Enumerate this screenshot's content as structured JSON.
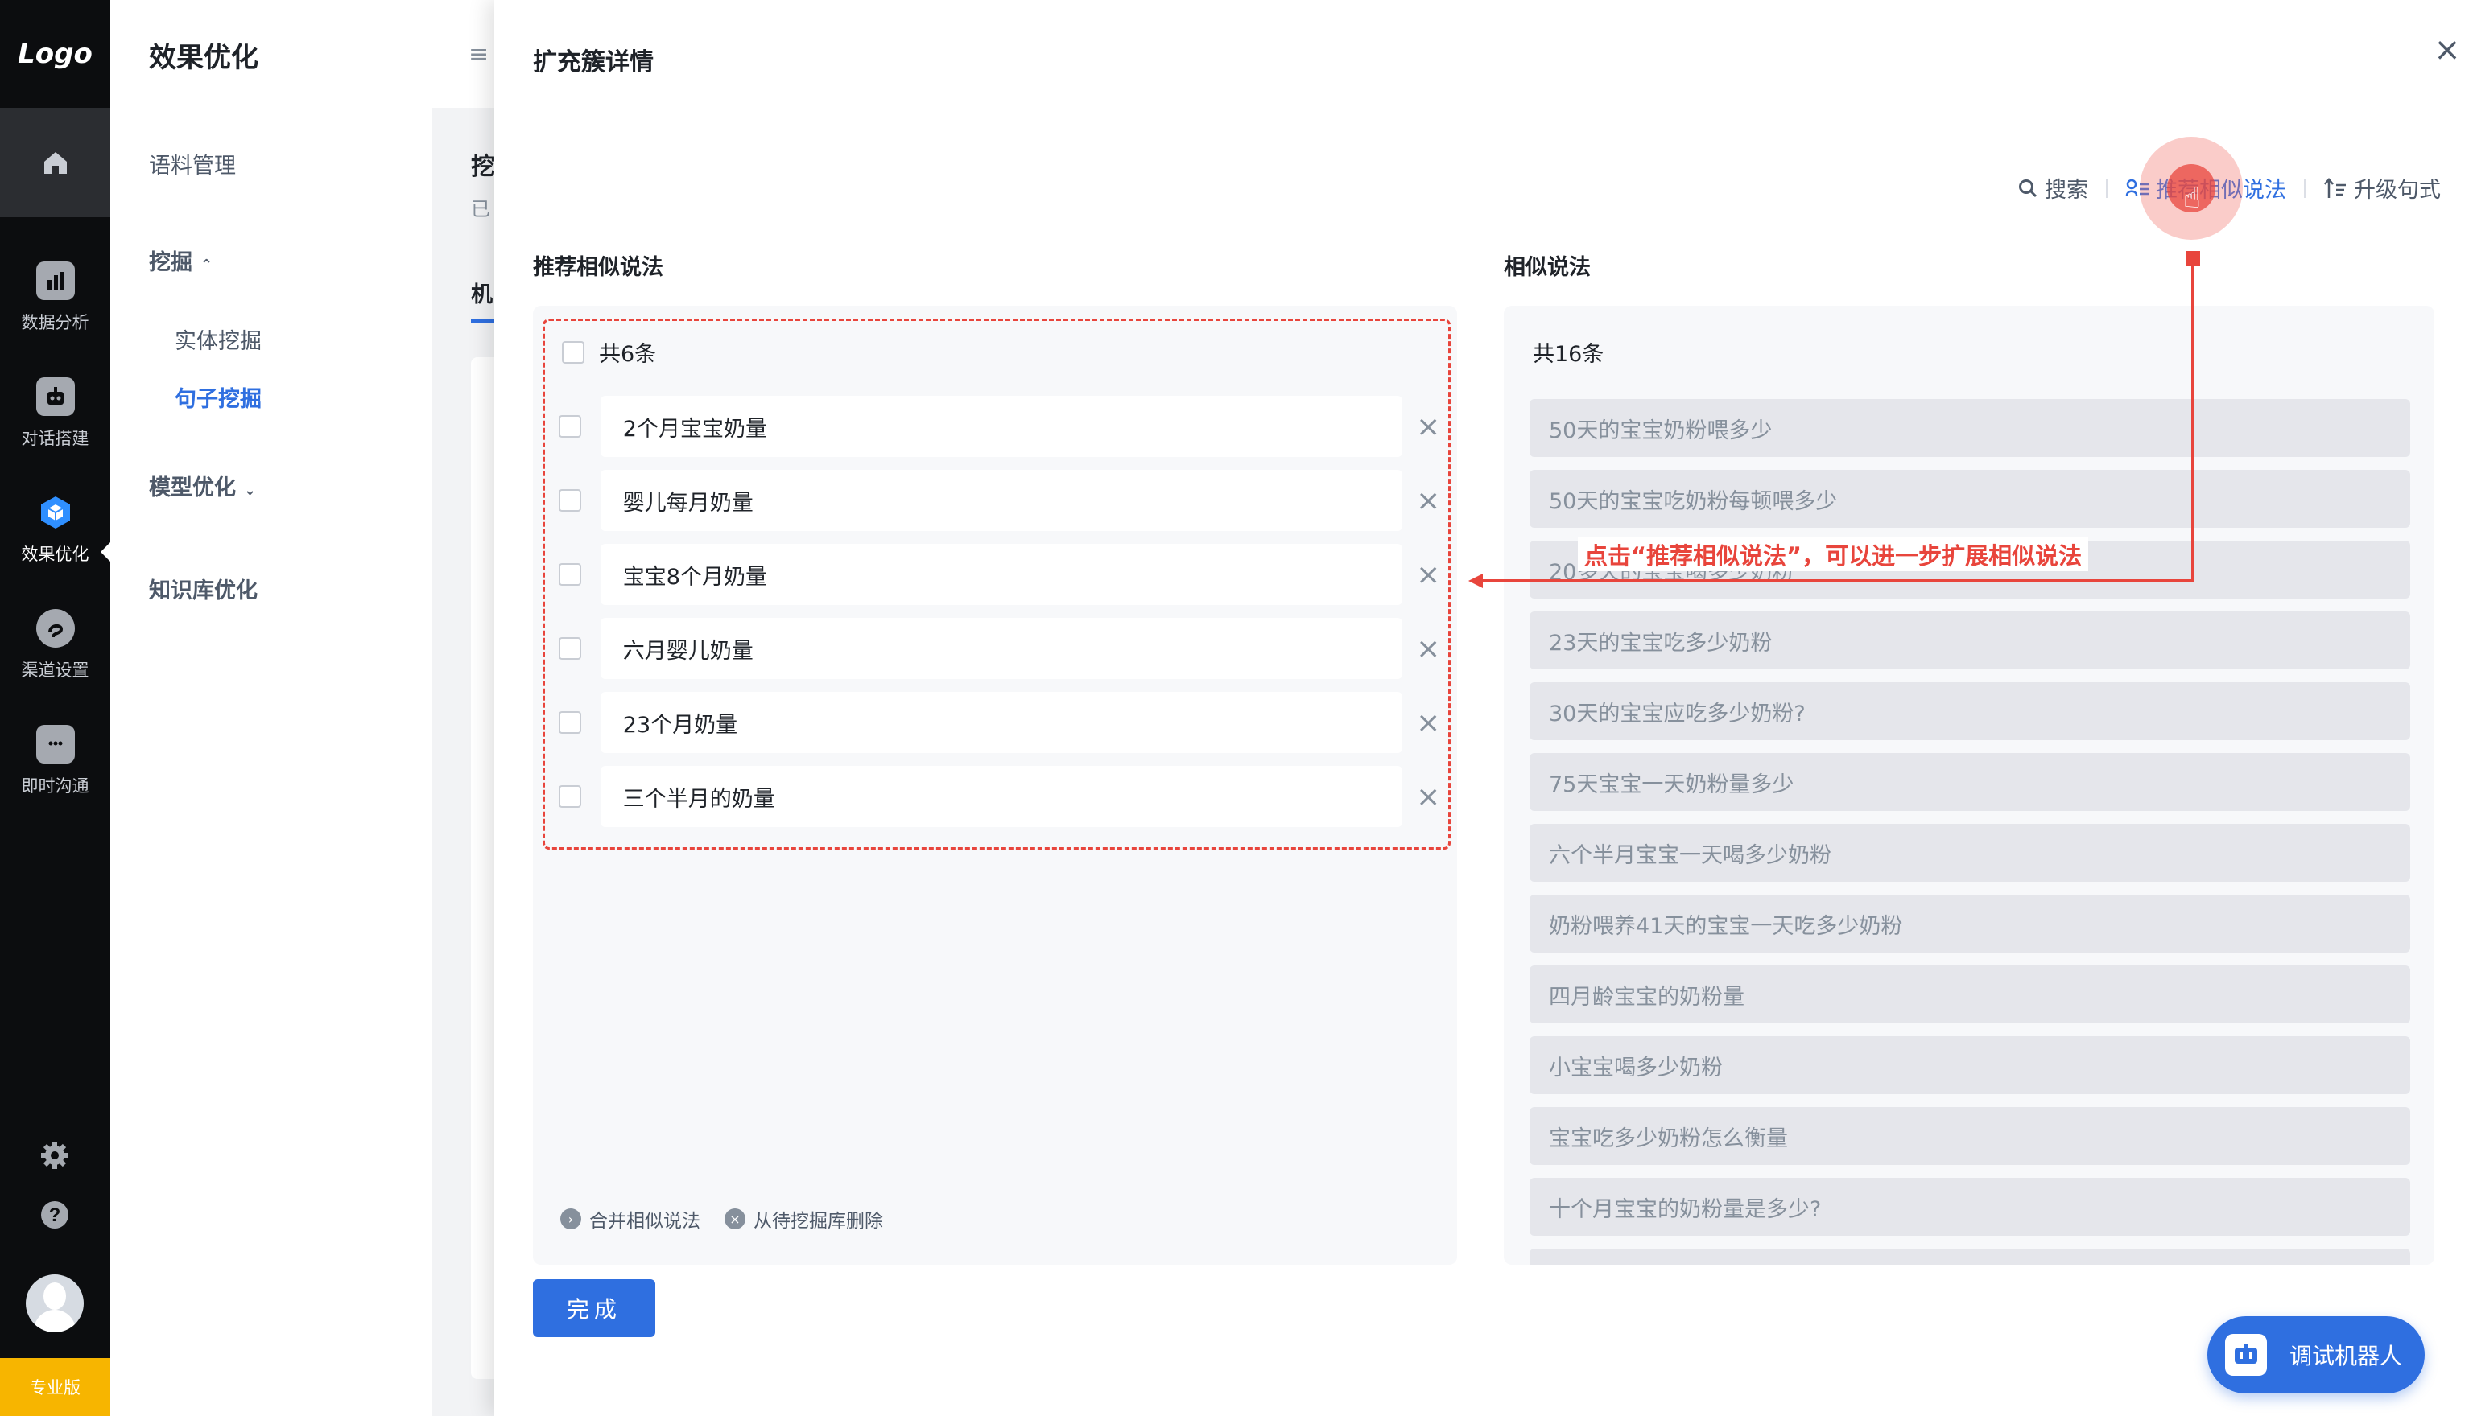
{
  "rail": {
    "logo": "Logo",
    "items": [
      {
        "label": "数据分析",
        "icon": "bar-chart-icon"
      },
      {
        "label": "对话搭建",
        "icon": "robot-icon"
      },
      {
        "label": "效果优化",
        "icon": "cube-icon",
        "active": true
      },
      {
        "label": "渠道设置",
        "icon": "channel-icon"
      },
      {
        "label": "即时沟通",
        "icon": "chat-icon"
      }
    ],
    "pro_label": "专业版"
  },
  "subnav": {
    "title": "效果优化",
    "items": {
      "corpus": "语料管理",
      "mining": "挖掘",
      "entity_mining": "实体挖掘",
      "sentence_mining": "句子挖掘",
      "model_opt": "模型优化",
      "kb_opt": "知识库优化"
    }
  },
  "background": {
    "title_fragment": "挖",
    "subtitle_fragment": "已",
    "tab_fragment": "机",
    "menu_icon": "≡"
  },
  "drawer": {
    "title": "扩充簇详情",
    "close": "×",
    "toolbar": {
      "search": "搜索",
      "recommend": "推荐相似说法",
      "upgrade": "升级句式"
    },
    "left": {
      "title": "推荐相似说法",
      "count": "共6条",
      "items": [
        "2个月宝宝奶量",
        "婴儿每月奶量",
        "宝宝8个月奶量",
        "六月婴儿奶量",
        "23个月奶量",
        "三个半月的奶量"
      ],
      "merge": "合并相似说法",
      "delete": "从待挖掘库删除"
    },
    "right": {
      "title": "相似说法",
      "count": "共16条",
      "items": [
        "50天的宝宝奶粉喂多少",
        "50天的宝宝吃奶粉每顿喂多少",
        "20多天的宝宝喝多少奶粉",
        "23天的宝宝吃多少奶粉",
        "30天的宝宝应吃多少奶粉?",
        "75天宝宝一天奶粉量多少",
        "六个半月宝宝一天喝多少奶粉",
        "奶粉喂养41天的宝宝一天吃多少奶粉",
        "四月龄宝宝的奶粉量",
        "小宝宝喝多少奶粉",
        "宝宝吃多少奶粉怎么衡量",
        "十个月宝宝的奶粉量是多少?"
      ]
    },
    "done": "完成"
  },
  "annotation": {
    "text": "点击“推荐相似说法”，可以进一步扩展相似说法"
  },
  "robot_button": "调试机器人",
  "colors": {
    "accent": "#2f6fe0",
    "annotation": "#e8453c",
    "rail_bg": "#0c0d0f",
    "pro_badge": "#f7b500"
  }
}
